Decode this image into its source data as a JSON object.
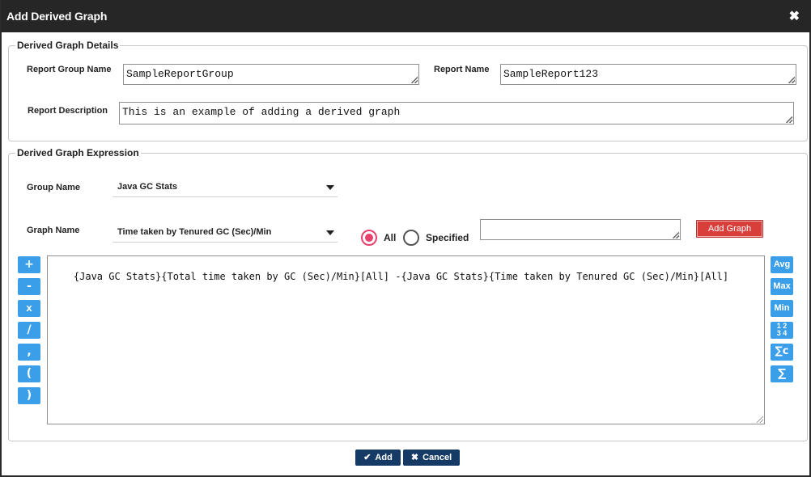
{
  "dialog": {
    "title": "Add Derived Graph",
    "close_glyph": "✖"
  },
  "details": {
    "legend": "Derived Graph Details",
    "report_group_label": "Report Group Name",
    "report_group_value": "SampleReportGroup",
    "report_name_label": "Report Name",
    "report_name_value": "SampleReport123",
    "report_desc_label": "Report Description",
    "report_desc_value": "This is an example of adding a derived graph"
  },
  "expression": {
    "legend": "Derived Graph Expression",
    "group_label": "Group Name",
    "group_value": "Java GC Stats",
    "graph_label": "Graph Name",
    "graph_value": "Time taken by Tenured GC (Sec)/Min",
    "radio_all": "All",
    "radio_specified": "Specified",
    "radio_selected": "All",
    "specified_value": "",
    "add_graph_label": "Add Graph",
    "text": "{Java GC Stats}{Total time taken by GC (Sec)/Min}[All] -{Java GC Stats}{Time taken by Tenured GC (Sec)/Min}[All]",
    "operators": [
      "+",
      "-",
      "x",
      "/",
      ",",
      "(",
      ")"
    ],
    "functions": {
      "avg": "Avg",
      "max": "Max",
      "min": "Min",
      "percentile_top": "1 2",
      "percentile_bottom": "3 4",
      "sum_count": "∑c",
      "sum": "∑"
    }
  },
  "footer": {
    "add_label": "Add",
    "cancel_label": "Cancel",
    "add_icon": "check-icon",
    "cancel_icon": "close-icon"
  }
}
